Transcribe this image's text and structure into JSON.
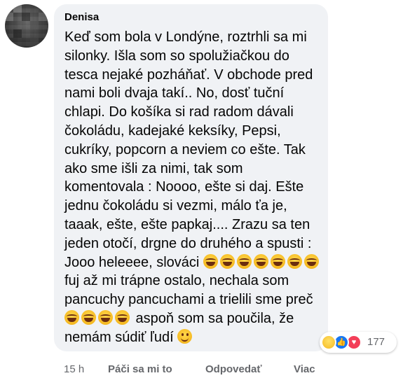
{
  "comment": {
    "author": "Denisa",
    "text_segments": [
      "Keď som bola v Londýne, roztrhli sa mi silonky. Išla som so spolužiačkou do tesca nejaké pozháňať. V obchode pred nami boli dvaja takí.. No, dosť tuční chlapi. Do košíka si rad radom dávali čokoládu, kadejaké keksíky, Pepsi, cukríky, popcorn a neviem co ešte. Tak ako sme išli za nimi, tak som komentovala : Noooo, ešte si daj. Ešte jednu čokoládu si vezmi, málo ťa je, taaak, ešte, ešte papkaj.... Zrazu sa ten jeden otočí, drgne do druhého a spusti : Jooo heleeee, slováci ",
      " fuj až mi trápne ostalo, nechala som pancuchy pancuchami a trielili sme preč ",
      " aspoň som sa poučila, že nemám súdiť ľudí "
    ],
    "emoji_names": [
      "face-with-tears-of-joy-icon",
      "slightly-smiling-face-icon"
    ]
  },
  "reactions": {
    "types": [
      "haha-reaction-icon",
      "like-reaction-icon",
      "love-reaction-icon"
    ],
    "count": "177"
  },
  "actions": {
    "time": "15 h",
    "like": "Páči sa mi to",
    "reply": "Odpovedať",
    "more": "Viac"
  },
  "colors": {
    "bubble": "#f0f2f5",
    "text": "#050505",
    "secondary": "#65676b",
    "like": "#1877f2",
    "love": "#f33e58"
  }
}
